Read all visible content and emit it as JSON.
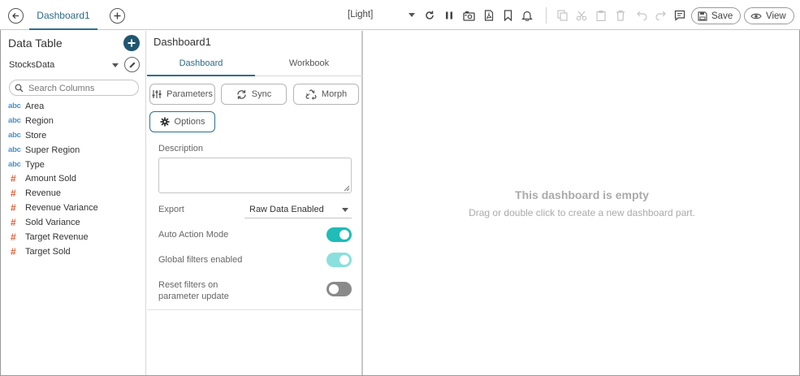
{
  "header": {
    "tab_title": "Dashboard1",
    "theme": "[Light]",
    "save_label": "Save",
    "view_label": "View",
    "icons": [
      "back-arrow-icon",
      "add-icon",
      "refresh-icon",
      "pause-icon",
      "snapshot-icon",
      "pdf-icon",
      "bookmark-icon",
      "bell-icon",
      "copy-icon",
      "cut-icon",
      "paste-icon",
      "delete-icon",
      "undo-icon",
      "redo-icon",
      "comment-icon",
      "save-icon",
      "eye-icon"
    ]
  },
  "data_table": {
    "title": "Data Table",
    "source": "StocksData",
    "search_placeholder": "Search Columns",
    "type_labels": {
      "text": "abc",
      "numeric": "#"
    },
    "columns": [
      {
        "type": "text",
        "name": "Area"
      },
      {
        "type": "text",
        "name": "Region"
      },
      {
        "type": "text",
        "name": "Store"
      },
      {
        "type": "text",
        "name": "Super Region"
      },
      {
        "type": "text",
        "name": "Type"
      },
      {
        "type": "numeric",
        "name": "Amount Sold"
      },
      {
        "type": "numeric",
        "name": "Revenue"
      },
      {
        "type": "numeric",
        "name": "Revenue Variance"
      },
      {
        "type": "numeric",
        "name": "Sold Variance"
      },
      {
        "type": "numeric",
        "name": "Target Revenue"
      },
      {
        "type": "numeric",
        "name": "Target Sold"
      }
    ]
  },
  "properties": {
    "title": "Dashboard1",
    "tabs": [
      {
        "label": "Dashboard",
        "active": true
      },
      {
        "label": "Workbook",
        "active": false
      }
    ],
    "buttons": {
      "parameters": "Parameters",
      "sync": "Sync",
      "morph": "Morph",
      "options": "Options"
    },
    "description_label": "Description",
    "description_value": "",
    "export_label": "Export",
    "export_value": "Raw Data Enabled",
    "toggles": {
      "auto_action": {
        "label": "Auto Action Mode",
        "state": "on"
      },
      "global_filters": {
        "label": "Global filters enabled",
        "state": "on-disabled"
      },
      "reset_filters": {
        "label": "Reset filters on parameter update",
        "state": "off"
      }
    },
    "colors": {
      "accent": "#2f6f8e",
      "toggle_on": "#1fbcb8",
      "toggle_off": "#8a8a8a"
    }
  },
  "canvas": {
    "empty_title": "This dashboard is empty",
    "empty_subtitle": "Drag or double click to create a new dashboard part."
  }
}
